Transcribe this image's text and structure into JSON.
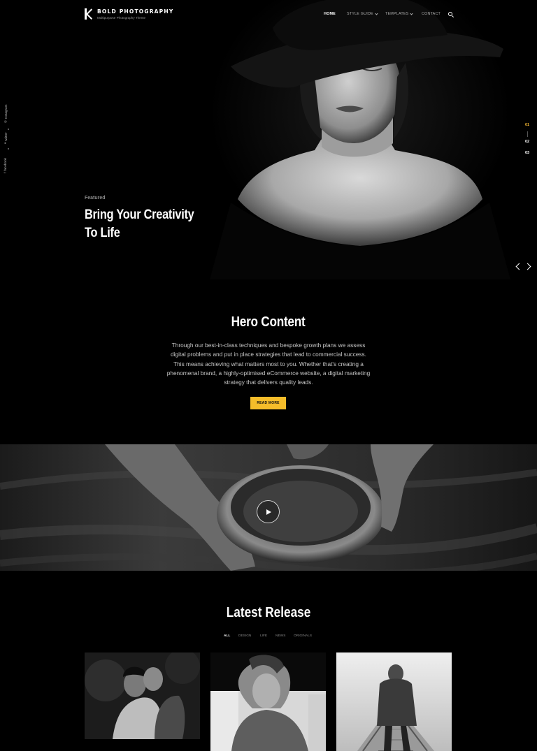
{
  "brand": {
    "title": "BOLD PHOTOGRAPHY",
    "subtitle": "Multipurpose Photography Theme"
  },
  "nav": {
    "items": [
      {
        "label": "HOME",
        "active": true,
        "has_dropdown": false
      },
      {
        "label": "STYLE GUIDE",
        "active": false,
        "has_dropdown": true
      },
      {
        "label": "TEMPLATES",
        "active": false,
        "has_dropdown": true
      },
      {
        "label": "CONTACT",
        "active": false,
        "has_dropdown": false
      }
    ],
    "search_icon": "search-icon"
  },
  "social": {
    "items": [
      {
        "label": "Instagram",
        "icon": "instagram-icon"
      },
      {
        "label": "twitter",
        "icon": "twitter-icon"
      },
      {
        "label": "facebook",
        "icon": "facebook-icon"
      }
    ]
  },
  "hero": {
    "featured_label": "Featured",
    "title_line1": "Bring Your Creativity",
    "title_line2": "To Life",
    "slides": [
      "01",
      "02",
      "03"
    ],
    "active_slide": "01",
    "accent_color": "#f2b632"
  },
  "hero_content": {
    "title": "Hero Content",
    "text": "Through our best-in-class techniques and bespoke growth plans we assess digital problems and put in place strategies that lead to commercial success. This means achieving what matters most to you. Whether that's creating a phenomenal brand, a highly-optimised eCommerce website, a digital marketing strategy that delivers quality leads.",
    "button": "READ MORE",
    "button_color": "#f5bd2a"
  },
  "video": {
    "play_icon": "play-icon"
  },
  "latest_release": {
    "title": "Latest Release",
    "filters": [
      {
        "label": "ALL",
        "active": true
      },
      {
        "label": "DESIGN",
        "active": false
      },
      {
        "label": "LIFE",
        "active": false
      },
      {
        "label": "NEWS",
        "active": false
      },
      {
        "label": "ORIGINALS",
        "active": false
      }
    ]
  }
}
